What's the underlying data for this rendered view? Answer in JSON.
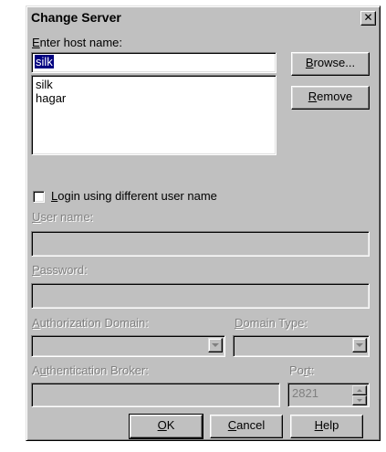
{
  "window": {
    "title": "Change Server",
    "close_glyph": "✕"
  },
  "host": {
    "label_mnemonic": "E",
    "label_rest": "nter host name:",
    "value": "silk",
    "list": [
      "silk",
      "hagar"
    ]
  },
  "buttons": {
    "browse_mnemonic": "B",
    "browse_rest": "rowse...",
    "remove_mnemonic": "R",
    "remove_rest": "emove",
    "ok_mnemonic": "O",
    "ok_rest": "K",
    "cancel_mnemonic": "C",
    "cancel_rest": "ancel",
    "help_mnemonic": "H",
    "help_rest": "elp"
  },
  "login": {
    "checkbox_mnemonic": "L",
    "checkbox_rest": "ogin using different user name",
    "checked": false
  },
  "fields": {
    "user_mnemonic": "U",
    "user_rest": "ser name:",
    "password_mnemonic": "P",
    "password_rest": "assword:",
    "auth_domain_mnemonic": "A",
    "auth_domain_rest": "uthorization Domain:",
    "domain_type_mnemonic": "D",
    "domain_type_rest": "omain Type:",
    "auth_broker_pre": "A",
    "auth_broker_mnemonic": "u",
    "auth_broker_rest": "thentication Broker:",
    "port_pre": "Po",
    "port_mnemonic": "r",
    "port_rest": "t:",
    "port_value": "2821"
  },
  "icons": [
    "close-icon",
    "dropdown-arrow-icon",
    "spin-up-icon",
    "spin-down-icon"
  ]
}
